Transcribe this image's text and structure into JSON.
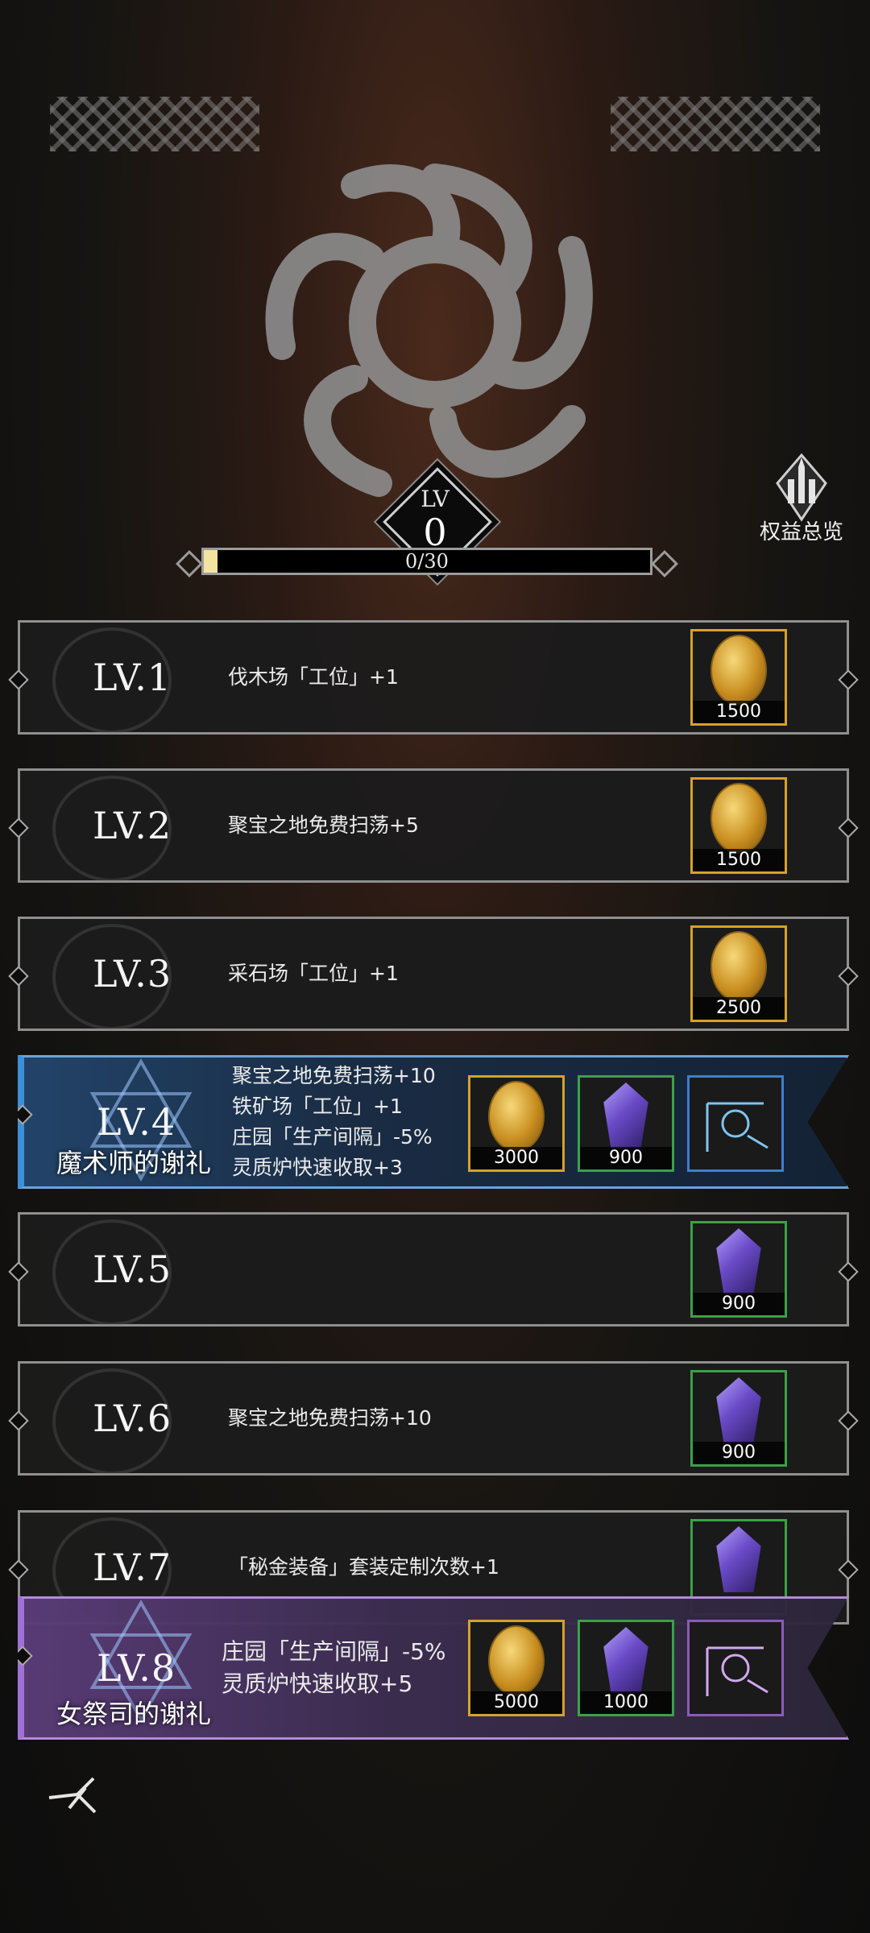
{
  "header": {
    "lv_label": "LV",
    "lv_value": "0",
    "progress_text": "0/30",
    "progress_fraction": 0.03
  },
  "overview": {
    "label": "权益总览",
    "icon": "castle-icon"
  },
  "levels": [
    {
      "lv": "LV.1",
      "desc": [
        "伐木场「工位」+1"
      ],
      "rewards": [
        {
          "type": "coin",
          "qty": "1500"
        }
      ]
    },
    {
      "lv": "LV.2",
      "desc": [
        "聚宝之地免费扫荡+5"
      ],
      "rewards": [
        {
          "type": "coin",
          "qty": "1500"
        }
      ]
    },
    {
      "lv": "LV.3",
      "desc": [
        "采石场「工位」+1"
      ],
      "rewards": [
        {
          "type": "coin",
          "qty": "2500"
        }
      ]
    },
    {
      "lv": "LV.4",
      "title": "魔术师的谢礼",
      "desc": [
        "聚宝之地免费扫荡+10",
        "铁矿场「工位」+1",
        "庄园「生产间隔」-5%",
        "灵质炉快速收取+3"
      ],
      "rewards": [
        {
          "type": "coin",
          "qty": "3000"
        },
        {
          "type": "gem",
          "qty": "900"
        },
        {
          "type": "frame-blue",
          "qty": ""
        }
      ]
    },
    {
      "lv": "LV.5",
      "desc": [],
      "rewards": [
        {
          "type": "gem",
          "qty": "900"
        }
      ]
    },
    {
      "lv": "LV.6",
      "desc": [
        "聚宝之地免费扫荡+10"
      ],
      "rewards": [
        {
          "type": "gem",
          "qty": "900"
        }
      ]
    },
    {
      "lv": "LV.7",
      "desc": [
        "「秘金装备」套装定制次数+1"
      ],
      "rewards": [
        {
          "type": "gem",
          "qty": ""
        }
      ]
    },
    {
      "lv": "LV.8",
      "title": "女祭司的谢礼",
      "desc": [
        "庄园「生产间隔」-5%",
        "灵质炉快速收取+5"
      ],
      "rewards": [
        {
          "type": "coin",
          "qty": "5000"
        },
        {
          "type": "gem",
          "qty": "1000"
        },
        {
          "type": "frame-purple",
          "qty": ""
        }
      ]
    }
  ],
  "colors": {
    "gold": "#d6a12a",
    "green": "#39a245",
    "blue": "#3e7ed0",
    "purple": "#8b5bb8"
  }
}
